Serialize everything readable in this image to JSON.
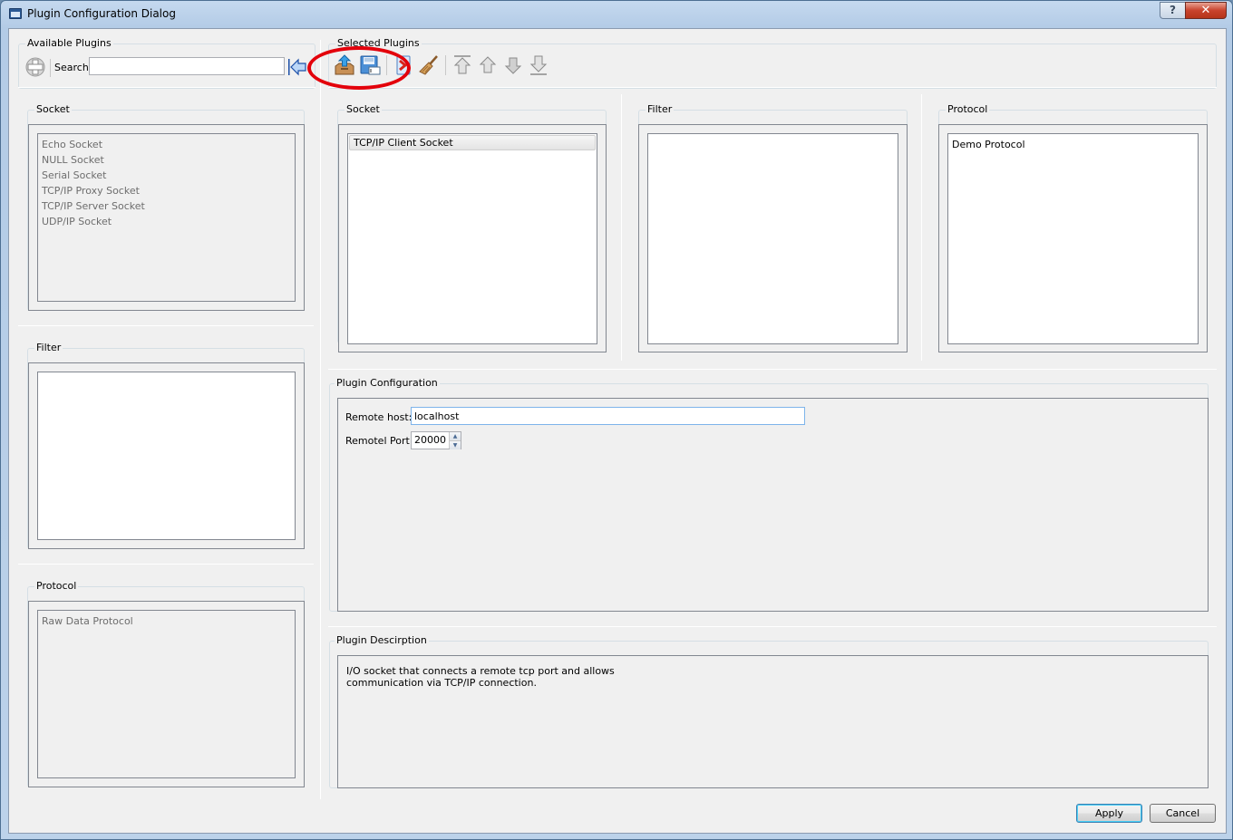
{
  "window": {
    "title": "Plugin Configuration Dialog",
    "help_label": "?",
    "close_label": "✕"
  },
  "available": {
    "title": "Available Plugins",
    "search_label": "Search:",
    "search_value": "",
    "icons": {
      "add": "plus-icon",
      "back": "arrow-left-icon"
    },
    "socket": {
      "title": "Socket",
      "items": [
        "Echo Socket",
        "NULL Socket",
        "Serial Socket",
        "TCP/IP Proxy Socket",
        "TCP/IP Server Socket",
        "UDP/IP Socket"
      ]
    },
    "filter": {
      "title": "Filter",
      "items": []
    },
    "protocol": {
      "title": "Protocol",
      "items": [
        "Raw Data Protocol"
      ]
    }
  },
  "selected": {
    "title": "Selected Plugins",
    "toolbar": [
      {
        "name": "import",
        "icon": "import-tray-icon"
      },
      {
        "name": "save",
        "icon": "save-floppy-icon"
      },
      {
        "name": "remove",
        "icon": "remove-icon"
      },
      {
        "name": "clear",
        "icon": "broom-icon"
      },
      {
        "name": "move-top",
        "icon": "arrow-top-icon"
      },
      {
        "name": "move-up",
        "icon": "arrow-up-icon"
      },
      {
        "name": "move-down",
        "icon": "arrow-down-icon"
      },
      {
        "name": "move-bottom",
        "icon": "arrow-bottom-icon"
      }
    ],
    "socket": {
      "title": "Socket",
      "items": [
        "TCP/IP Client Socket"
      ],
      "selected_index": 0
    },
    "filter": {
      "title": "Filter",
      "items": []
    },
    "protocol": {
      "title": "Protocol",
      "items": [
        "Demo Protocol"
      ]
    }
  },
  "config": {
    "title": "Plugin Configuration",
    "remote_host_label": "Remote host:",
    "remote_host_value": "localhost",
    "remote_port_label": "Remotel Port:",
    "remote_port_value": "20000"
  },
  "description": {
    "title": "Plugin Descirption",
    "line1": "I/O socket that connects a remote tcp port and allows",
    "line2": "communication via TCP/IP connection."
  },
  "buttons": {
    "apply": "Apply",
    "cancel": "Cancel"
  },
  "annotation_color": "#e3000b"
}
